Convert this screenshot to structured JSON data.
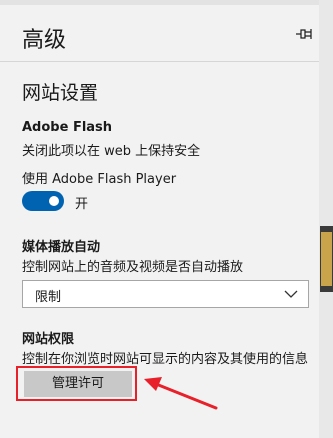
{
  "header": {
    "title": "高级",
    "pin_icon": "pin-icon"
  },
  "site_settings": {
    "title": "网站设置"
  },
  "flash": {
    "title": "Adobe Flash",
    "description": "关闭此项以在 web 上保持安全",
    "toggle_label": "使用 Adobe Flash Player",
    "toggle_state": "开",
    "toggle_on": true
  },
  "autoplay": {
    "title": "媒体播放自动",
    "description": "控制网站上的音频及视频是否自动播放",
    "selected": "限制"
  },
  "permissions": {
    "title": "网站权限",
    "description": "控制在你浏览时网站可显示的内容及其使用的信息",
    "button_label": "管理许可"
  },
  "colors": {
    "accent": "#0063b1",
    "highlight": "#e8202a"
  }
}
